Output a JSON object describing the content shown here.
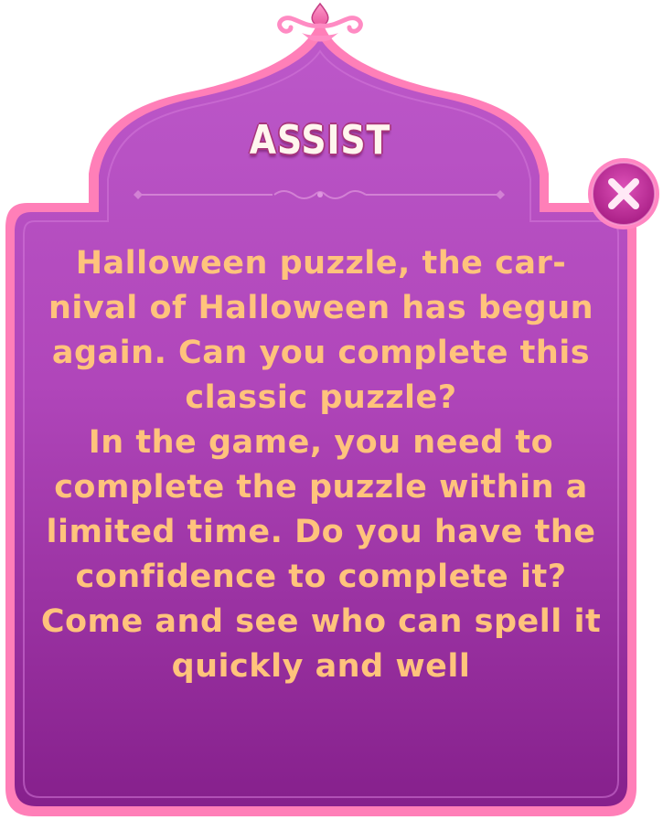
{
  "dialog": {
    "title": "ASSIST",
    "paragraphs": [
      "Halloween puzzle, the car-nival of Halloween has begun again. Can you complete this classic puzzle?",
      "In the game, you need to complete the puzzle within a limited time. Do you have the confidence to complete it? Come and see who can spell it quickly and well"
    ],
    "close_icon": "close-icon"
  },
  "colors": {
    "panel_top": "#b54fc3",
    "panel_bottom": "#8a238f",
    "border": "#ff7fb9",
    "title_text": "#fff6ee",
    "body_text": "#ffc37c",
    "close_button": "#c2339e"
  }
}
